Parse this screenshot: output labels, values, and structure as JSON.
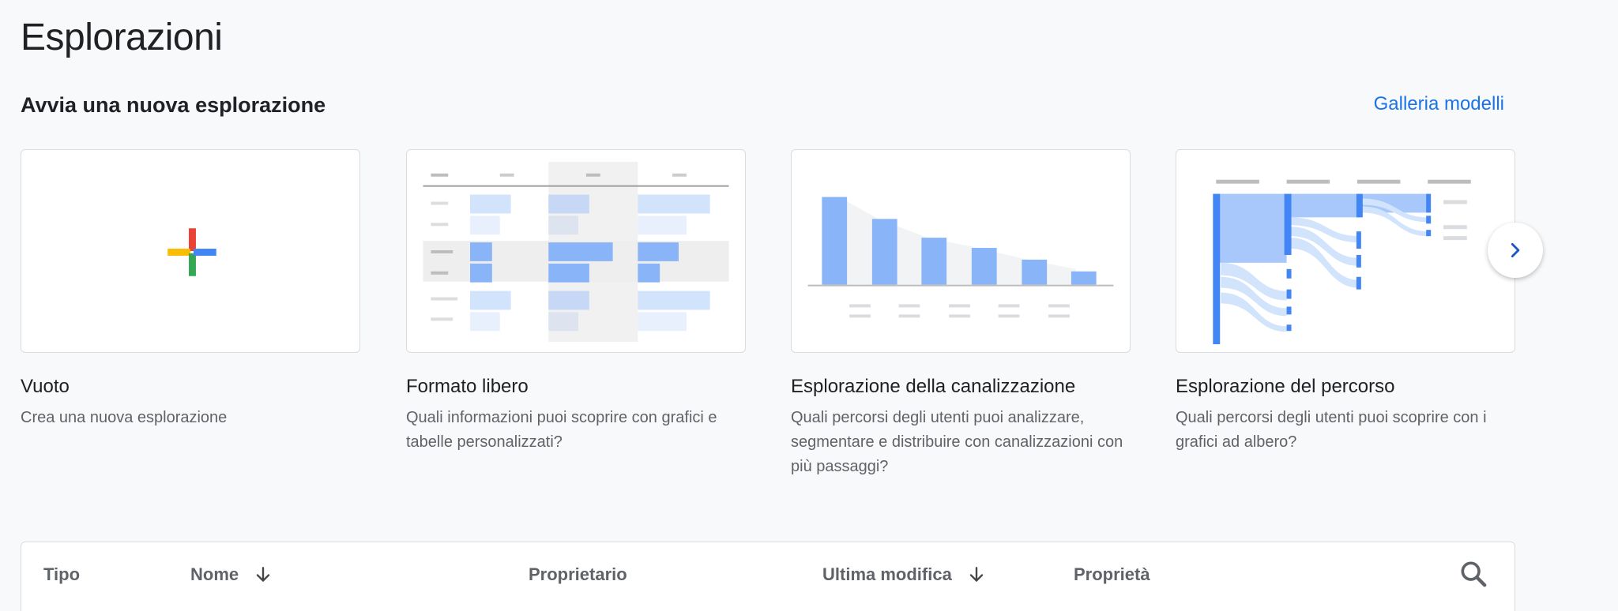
{
  "page": {
    "title": "Esplorazioni"
  },
  "section": {
    "title": "Avvia una nuova esplorazione",
    "gallery_link": "Galleria modelli"
  },
  "templates": [
    {
      "name": "Vuoto",
      "description": "Crea una nuova esplorazione"
    },
    {
      "name": "Formato libero",
      "description": "Quali informazioni puoi scoprire con grafici e tabelle personalizzati?"
    },
    {
      "name": "Esplorazione della canalizzazione",
      "description": "Quali percorsi degli utenti puoi analizzare, segmentare e distribuire con canalizzazioni con più passaggi?"
    },
    {
      "name": "Esplorazione del percorso",
      "description": "Quali percorsi degli utenti puoi scoprire con i grafici ad albero?"
    }
  ],
  "table": {
    "columns": [
      "Tipo",
      "Nome",
      "Proprietario",
      "Ultima modifica",
      "Proprietà"
    ]
  },
  "colors": {
    "accent": "#1a73e8",
    "plus_red": "#ea4335",
    "plus_yellow": "#fbbc04",
    "plus_green": "#34a853",
    "plus_blue": "#4285f4",
    "chart_blue": "#8ab4f8",
    "chart_light": "#d2e3fc"
  }
}
